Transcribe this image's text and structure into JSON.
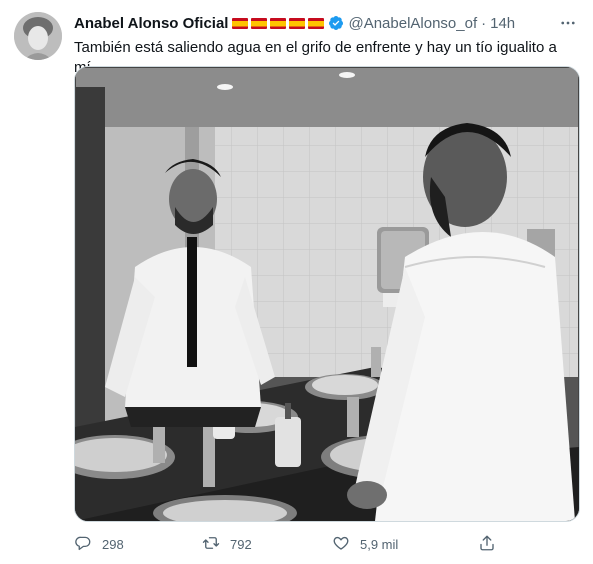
{
  "tweet": {
    "author_name": "Anabel Alonso Oficial",
    "flag_count": 5,
    "handle": "@AnabelAlonso_of",
    "separator": "·",
    "time": "14h",
    "text": "También está saliendo agua en el grifo de enfrente y hay un tío igualito a mí."
  },
  "actions": {
    "reply_count": "298",
    "retweet_count": "792",
    "like_count": "5,9 mil"
  },
  "icons": {
    "more": "more-horizontal-icon",
    "reply": "reply-icon",
    "retweet": "retweet-icon",
    "like": "heart-icon",
    "share": "share-icon",
    "verified": "verified-badge-icon"
  },
  "colors": {
    "text": "#0f1419",
    "secondary": "#536471",
    "verified": "#1d9bf0",
    "border": "#cfd9de"
  }
}
